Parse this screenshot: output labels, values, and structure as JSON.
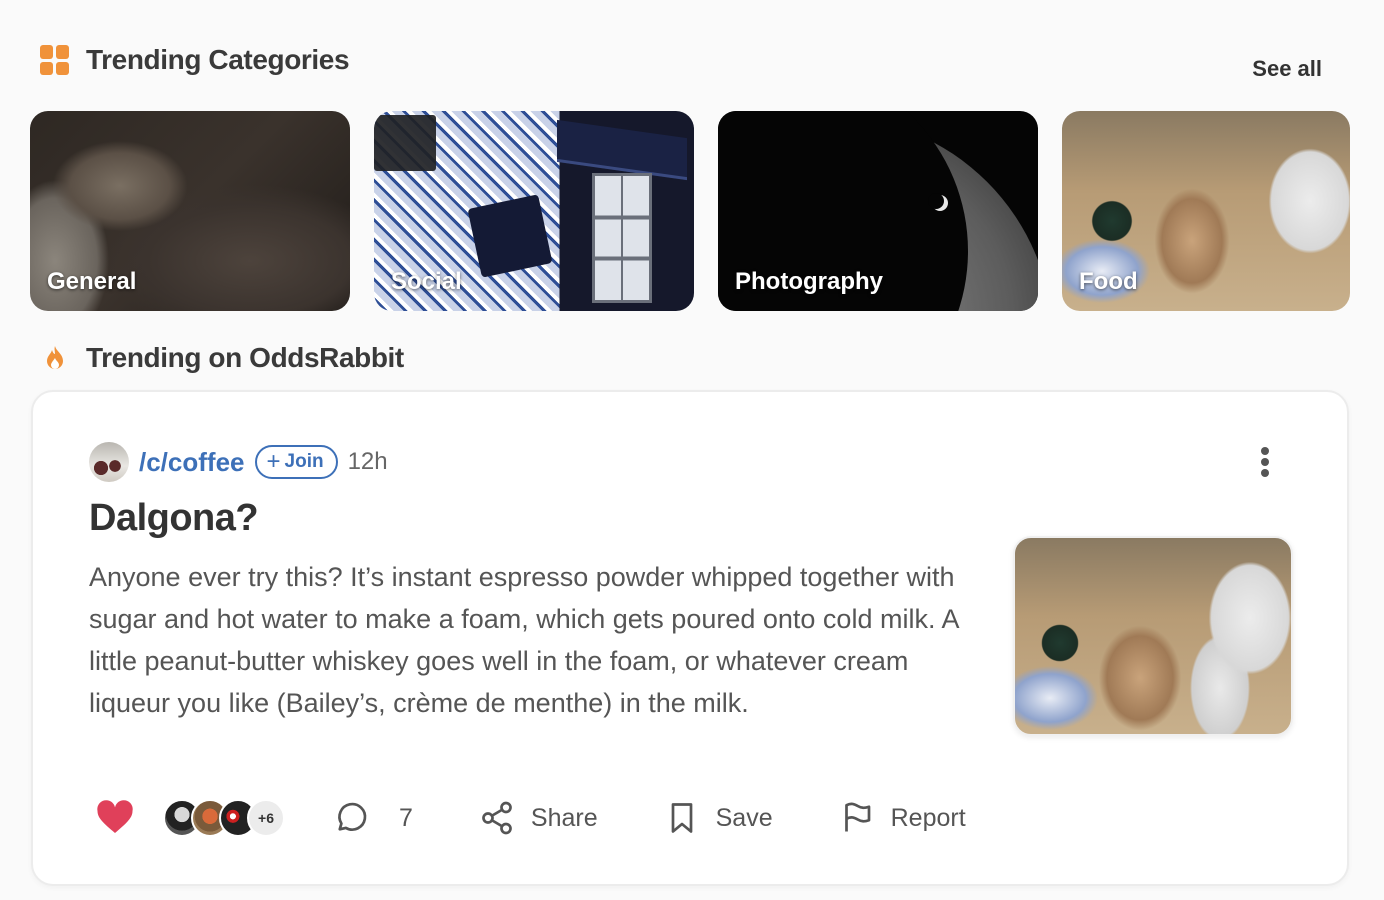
{
  "trending_categories": {
    "title": "Trending Categories",
    "see_all_label": "See all",
    "categories": [
      {
        "label": "General"
      },
      {
        "label": "Social"
      },
      {
        "label": "Photography"
      },
      {
        "label": "Food"
      }
    ]
  },
  "trending_feed": {
    "title": "Trending on OddsRabbit"
  },
  "post": {
    "community": "/c/coffee",
    "join_label": "Join",
    "join_plus": "+",
    "time": "12h",
    "title": "Dalgona?",
    "body": "Anyone ever try this? It’s instant espresso powder whipped together with sugar and hot water to make a foam, which gets poured onto cold milk. A little peanut-butter whiskey goes well in the foam, or whatever cream liqueur you like (Bailey’s, crème de menthe) in the milk.",
    "voters_more": "+6",
    "comment_count": "7",
    "share_label": "Share",
    "save_label": "Save",
    "report_label": "Report"
  },
  "colors": {
    "accent_orange": "#f0923a",
    "link_blue": "#3d70b8",
    "heart_red": "#e0405a"
  },
  "icons": [
    "grid-icon",
    "flame-icon",
    "kebab-menu-icon",
    "heart-icon",
    "comment-icon",
    "share-icon",
    "bookmark-icon",
    "flag-icon"
  ]
}
